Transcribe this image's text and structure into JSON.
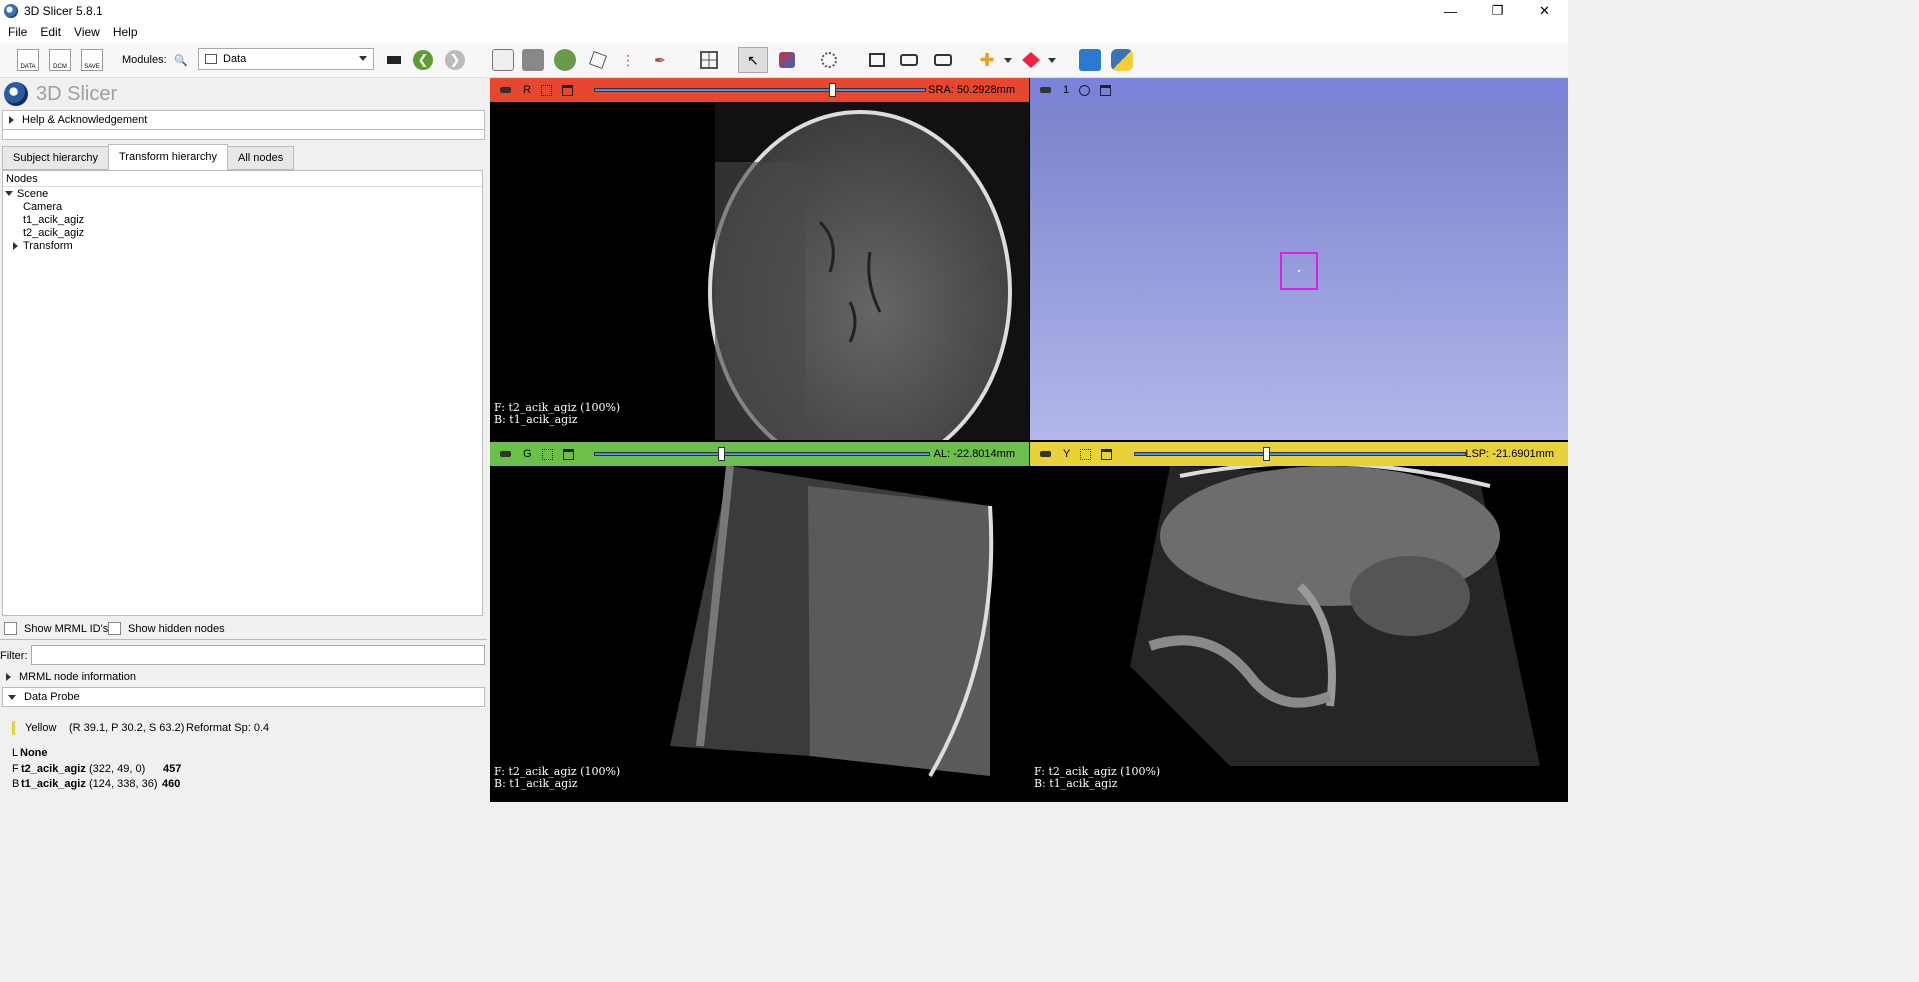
{
  "window": {
    "title": "3D Slicer 5.8.1",
    "minimize": "—",
    "maximize": "❐",
    "close": "✕"
  },
  "menu": [
    "File",
    "Edit",
    "View",
    "Help"
  ],
  "toolbar": {
    "data_label": "DATA",
    "dcm_label": "DCM",
    "save_label": "SAVE",
    "modules_label": "Modules:",
    "module_selected": "Data"
  },
  "logo_text": "3D Slicer",
  "help_section": "Help & Acknowledgement",
  "tabs": [
    "Subject hierarchy",
    "Transform hierarchy",
    "All nodes"
  ],
  "tree": {
    "header": "Nodes",
    "items": [
      {
        "label": "Scene",
        "level": 0
      },
      {
        "label": "Camera",
        "level": 1
      },
      {
        "label": "t1_acik_agiz",
        "level": 1
      },
      {
        "label": "t2_acik_agiz",
        "level": 1
      },
      {
        "label": "Transform",
        "level": 1
      }
    ]
  },
  "options": {
    "show_mrml_ids": "Show MRML ID's",
    "show_hidden": "Show hidden nodes"
  },
  "filter_label": "Filter:",
  "mrml_info": "MRML node information",
  "data_probe": {
    "title": "Data Probe",
    "view": "Yellow",
    "coords": "(R 39.1, P 30.2, S 63.2)",
    "reformat": "Reformat Sp: 0.4",
    "l_label": "L",
    "l_value": "None",
    "f_label": "F",
    "f_name": "t2_acik_agiz",
    "f_ijk": "(322,  49,   0)",
    "f_val": "457",
    "b_label": "B",
    "b_name": "t1_acik_agiz",
    "b_ijk": "(124, 338,  36)",
    "b_val": "460"
  },
  "views": {
    "red": {
      "letter": "R",
      "value": "SRA: 50.2928mm",
      "slider_fraction": 0.72,
      "fg": "F: t2_acik_agiz (100%)",
      "bg": "B: t1_acik_agiz",
      "color": "#e8472f"
    },
    "threed": {
      "letter": "1",
      "color": "#7a83d9"
    },
    "green": {
      "letter": "G",
      "value": "AL: -22.8014mm",
      "slider_fraction": 0.38,
      "fg": "F: t2_acik_agiz (100%)",
      "bg": "B: t1_acik_agiz",
      "color": "#6bbf4a"
    },
    "yellow": {
      "letter": "Y",
      "value": "LSP: -21.6901mm",
      "slider_fraction": 0.4,
      "fg": "F: t2_acik_agiz (100%)",
      "bg": "B: t1_acik_agiz",
      "color": "#e8d23a"
    }
  }
}
